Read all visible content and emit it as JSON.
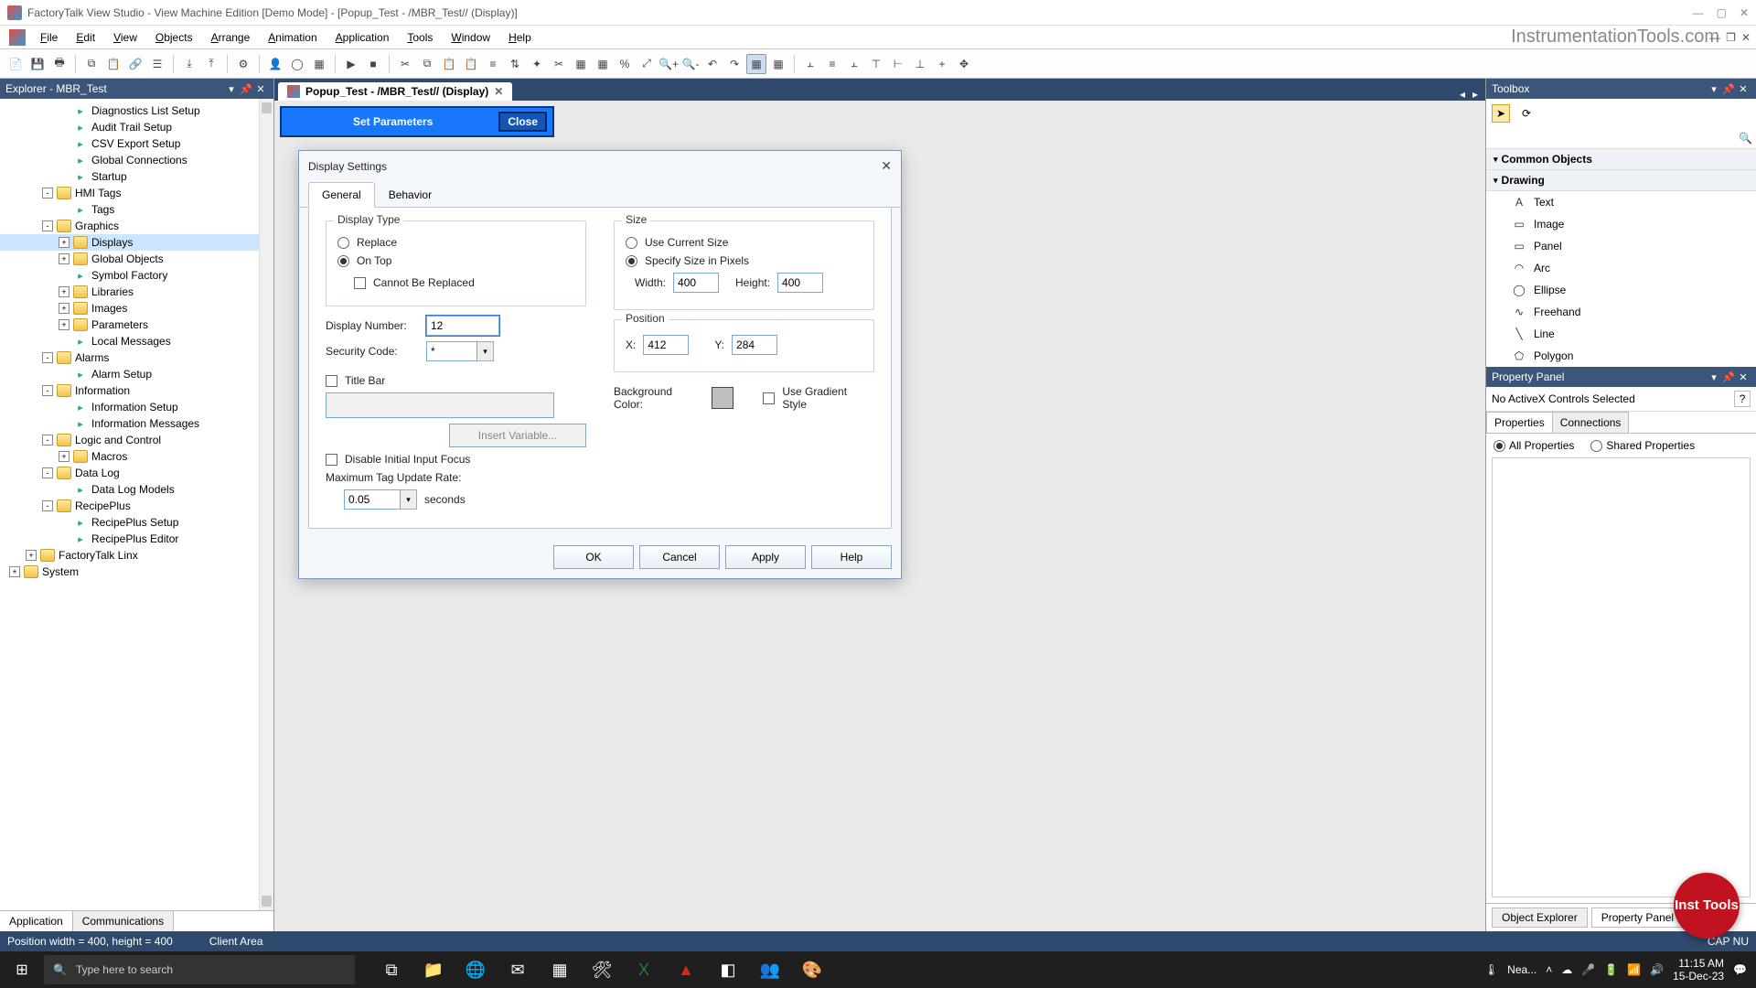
{
  "title": "FactoryTalk View Studio - View Machine Edition  [Demo Mode] - [Popup_Test - /MBR_Test// (Display)]",
  "watermark": "InstrumentationTools.com",
  "menu": [
    "File",
    "Edit",
    "View",
    "Objects",
    "Arrange",
    "Animation",
    "Application",
    "Tools",
    "Window",
    "Help"
  ],
  "explorer": {
    "title": "Explorer - MBR_Test",
    "items": [
      {
        "indent": 3,
        "toggle": "",
        "icon": "leaf",
        "label": "Diagnostics List Setup"
      },
      {
        "indent": 3,
        "toggle": "",
        "icon": "leaf",
        "label": "Audit Trail Setup"
      },
      {
        "indent": 3,
        "toggle": "",
        "icon": "leaf",
        "label": "CSV Export Setup"
      },
      {
        "indent": 3,
        "toggle": "",
        "icon": "leaf",
        "label": "Global Connections"
      },
      {
        "indent": 3,
        "toggle": "",
        "icon": "leaf",
        "label": "Startup"
      },
      {
        "indent": 2,
        "toggle": "-",
        "icon": "folder",
        "label": "HMI Tags"
      },
      {
        "indent": 3,
        "toggle": "",
        "icon": "leaf",
        "label": "Tags"
      },
      {
        "indent": 2,
        "toggle": "-",
        "icon": "folder",
        "label": "Graphics"
      },
      {
        "indent": 3,
        "toggle": "+",
        "icon": "folder",
        "label": "Displays",
        "selected": true
      },
      {
        "indent": 3,
        "toggle": "+",
        "icon": "folder",
        "label": "Global Objects"
      },
      {
        "indent": 3,
        "toggle": "",
        "icon": "leaf",
        "label": "Symbol Factory"
      },
      {
        "indent": 3,
        "toggle": "+",
        "icon": "folder",
        "label": "Libraries"
      },
      {
        "indent": 3,
        "toggle": "+",
        "icon": "folder",
        "label": "Images"
      },
      {
        "indent": 3,
        "toggle": "+",
        "icon": "folder",
        "label": "Parameters"
      },
      {
        "indent": 3,
        "toggle": "",
        "icon": "leaf",
        "label": "Local Messages"
      },
      {
        "indent": 2,
        "toggle": "-",
        "icon": "folder",
        "label": "Alarms"
      },
      {
        "indent": 3,
        "toggle": "",
        "icon": "leaf",
        "label": "Alarm Setup"
      },
      {
        "indent": 2,
        "toggle": "-",
        "icon": "folder",
        "label": "Information"
      },
      {
        "indent": 3,
        "toggle": "",
        "icon": "leaf",
        "label": "Information Setup"
      },
      {
        "indent": 3,
        "toggle": "",
        "icon": "leaf",
        "label": "Information Messages"
      },
      {
        "indent": 2,
        "toggle": "-",
        "icon": "folder",
        "label": "Logic and Control"
      },
      {
        "indent": 3,
        "toggle": "+",
        "icon": "folder",
        "label": "Macros"
      },
      {
        "indent": 2,
        "toggle": "-",
        "icon": "folder",
        "label": "Data Log"
      },
      {
        "indent": 3,
        "toggle": "",
        "icon": "leaf",
        "label": "Data Log Models"
      },
      {
        "indent": 2,
        "toggle": "-",
        "icon": "folder",
        "label": "RecipePlus"
      },
      {
        "indent": 3,
        "toggle": "",
        "icon": "leaf",
        "label": "RecipePlus Setup"
      },
      {
        "indent": 3,
        "toggle": "",
        "icon": "leaf",
        "label": "RecipePlus Editor"
      },
      {
        "indent": 1,
        "toggle": "+",
        "icon": "folder",
        "label": "FactoryTalk Linx"
      },
      {
        "indent": 0,
        "toggle": "+",
        "icon": "folder",
        "label": "System"
      }
    ],
    "tabs": [
      "Application",
      "Communications"
    ],
    "active_tab": 0
  },
  "doc_tab": {
    "label": "Popup_Test - /MBR_Test// (Display)"
  },
  "popup": {
    "title": "Set Parameters",
    "close": "Close"
  },
  "dialog": {
    "title": "Display Settings",
    "tabs": [
      "General",
      "Behavior"
    ],
    "active_tab": 0,
    "display_type": {
      "legend": "Display Type",
      "replace": "Replace",
      "ontop": "On Top",
      "cannot": "Cannot Be Replaced",
      "selected": "ontop"
    },
    "display_number": {
      "label": "Display Number:",
      "value": "12"
    },
    "security": {
      "label": "Security Code:",
      "value": "*"
    },
    "titlebar": {
      "label": "Title Bar",
      "value": ""
    },
    "insert_var": "Insert Variable...",
    "disable_focus": "Disable Initial Input Focus",
    "update_rate": {
      "label": "Maximum Tag Update Rate:",
      "value": "0.05",
      "unit": "seconds"
    },
    "size": {
      "legend": "Size",
      "use_current": "Use Current Size",
      "specify": "Specify Size in Pixels",
      "selected": "specify",
      "width_l": "Width:",
      "width": "400",
      "height_l": "Height:",
      "height": "400"
    },
    "position": {
      "legend": "Position",
      "xl": "X:",
      "x": "412",
      "yl": "Y:",
      "y": "284"
    },
    "bg": {
      "label": "Background Color:",
      "gradient": "Use Gradient Style"
    },
    "buttons": {
      "ok": "OK",
      "cancel": "Cancel",
      "apply": "Apply",
      "help": "Help"
    }
  },
  "toolbox": {
    "title": "Toolbox",
    "sections": [
      {
        "name": "Common Objects",
        "items": []
      },
      {
        "name": "Drawing",
        "items": [
          {
            "icon": "A",
            "label": "Text"
          },
          {
            "icon": "▭",
            "label": "Image"
          },
          {
            "icon": "▭",
            "label": "Panel"
          },
          {
            "icon": "◠",
            "label": "Arc"
          },
          {
            "icon": "◯",
            "label": "Ellipse"
          },
          {
            "icon": "∿",
            "label": "Freehand"
          },
          {
            "icon": "╲",
            "label": "Line"
          },
          {
            "icon": "⬠",
            "label": "Polygon"
          }
        ]
      }
    ]
  },
  "property_panel": {
    "title": "Property Panel",
    "msg": "No ActiveX Controls Selected",
    "tabs": [
      "Properties",
      "Connections"
    ],
    "radios": [
      "All Properties",
      "Shared Properties"
    ],
    "bottom_tabs": [
      "Object Explorer",
      "Property Panel"
    ],
    "active_bottom": 1
  },
  "statusbar": {
    "left": "Position width = 400, height = 400",
    "mid": "Client Area",
    "right": "CAP  NU"
  },
  "badge": "Inst Tools",
  "taskbar": {
    "search_placeholder": "Type here to search",
    "weather": "Nea...",
    "time": "11:15 AM",
    "date": "15-Dec-23"
  }
}
